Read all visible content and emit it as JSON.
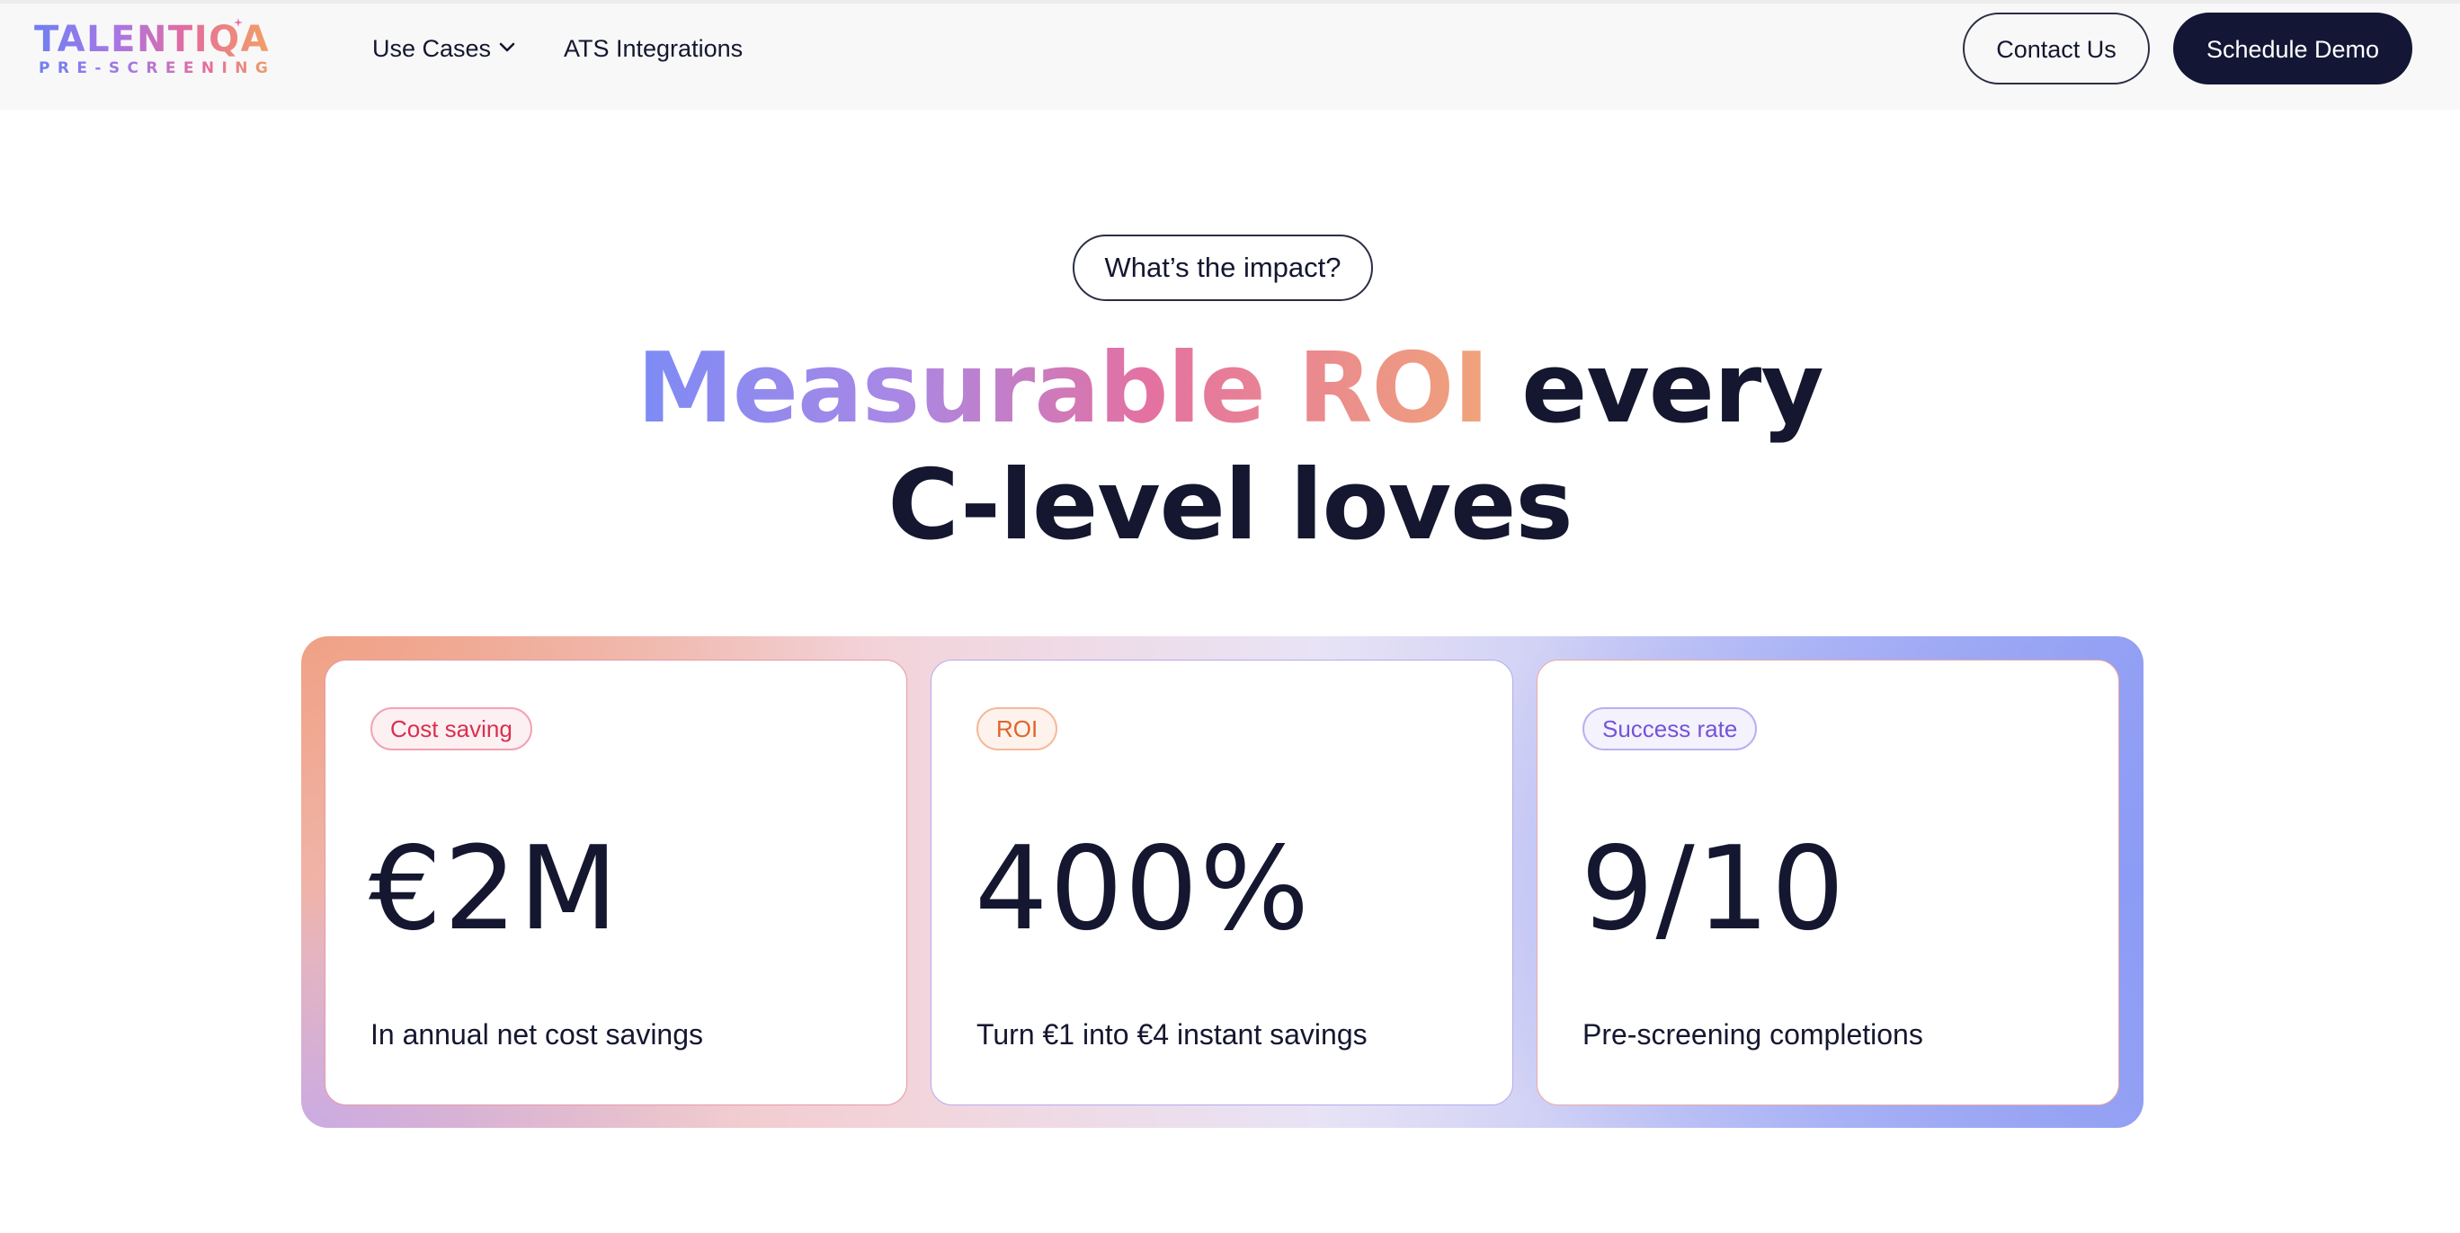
{
  "nav": {
    "logo_main": "TALENTIQA",
    "logo_sub": "PRE-SCREENING",
    "use_cases": "Use Cases",
    "ats_integrations": "ATS Integrations",
    "contact_us": "Contact Us",
    "schedule_demo": "Schedule Demo"
  },
  "hero": {
    "pill": "What’s the impact?",
    "headline_gradient": "Measurable ROI",
    "headline_rest_line1": " every",
    "headline_line2": "C-level loves"
  },
  "stats": [
    {
      "tag": "Cost saving",
      "value": "€2M",
      "description": "In annual net cost savings"
    },
    {
      "tag": "ROI",
      "value": "400%",
      "description": "Turn €1 into €4 instant savings"
    },
    {
      "tag": "Success rate",
      "value": "9/10",
      "description": "Pre-screening completions"
    }
  ],
  "colors": {
    "navy": "#131735",
    "text": "#14172f",
    "cost_tag": "#d8304f",
    "roi_tag": "#e0652c",
    "success_tag": "#7653d6"
  },
  "icons": {
    "dropdown": "chevron-down-icon"
  }
}
